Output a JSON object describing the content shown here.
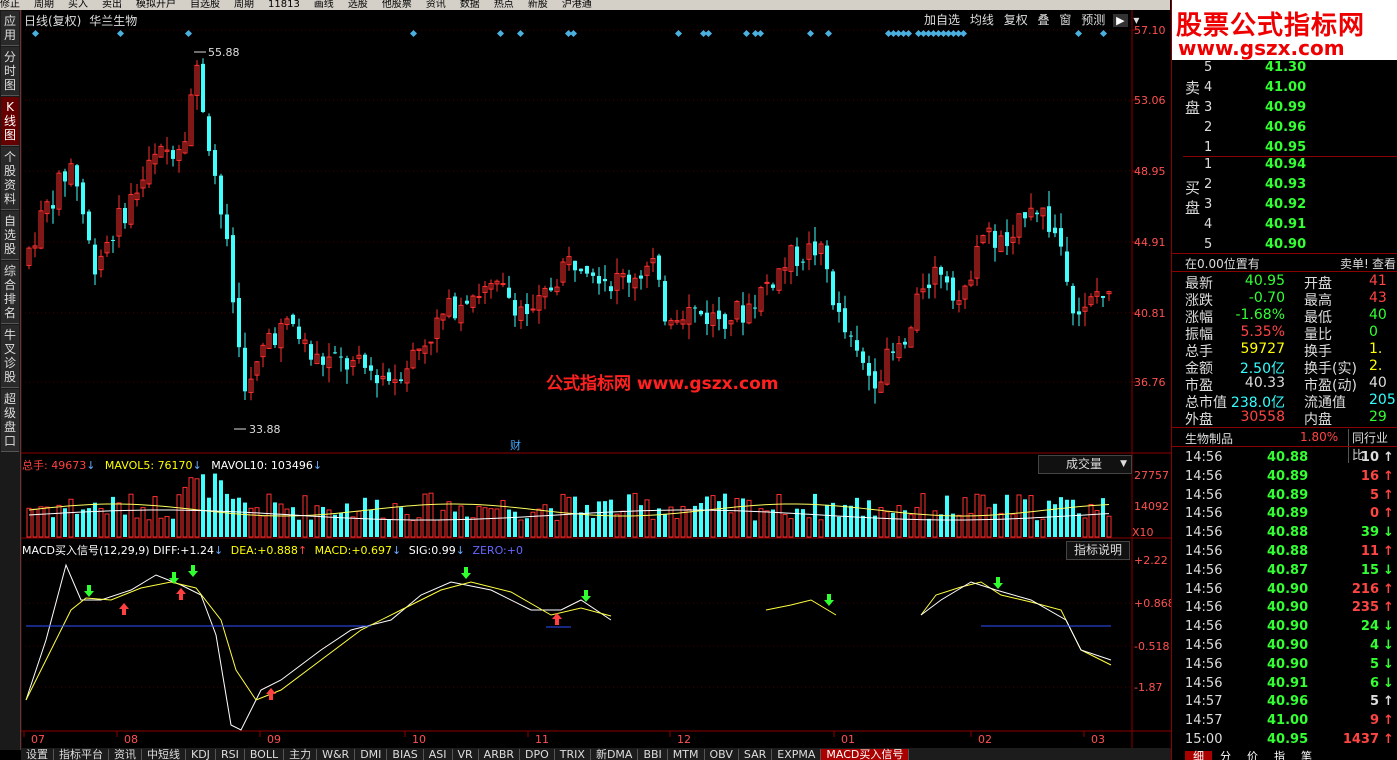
{
  "top_menu": [
    "修正",
    "周期",
    "买入",
    "卖出",
    "模拟开户",
    "自选股",
    "周期",
    "11813",
    "画线",
    "选股",
    "他股票",
    "资讯",
    "数据",
    "热点",
    "新股",
    "沪港通"
  ],
  "sidebar": [
    {
      "label": "应用",
      "active": false
    },
    {
      "label": "分时图",
      "active": false
    },
    {
      "label": "K线图",
      "active": true
    },
    {
      "label": "个股资料",
      "active": false
    },
    {
      "label": "自选股",
      "active": false
    },
    {
      "label": "综合排名",
      "active": false
    },
    {
      "label": "牛叉诊股",
      "active": false
    },
    {
      "label": "超级盘口",
      "active": false
    }
  ],
  "chart": {
    "title_period": "日线(复权)",
    "stock_name": "华兰生物",
    "toolbar": [
      "加自选",
      "均线",
      "复权",
      "叠",
      "窗",
      "预测"
    ],
    "toolbar_arrow": "▶",
    "price_labels": [
      "57.10",
      "53.06",
      "48.95",
      "44.91",
      "40.81",
      "36.76"
    ],
    "high_marker": "55.88",
    "low_marker": "33.88",
    "cai_marker": "财",
    "watermark": "公式指标网  www.gszx.com",
    "volume_header": {
      "label": "总手",
      "value": "49673",
      "ma5_label": "MAVOL5",
      "ma5_value": "76170",
      "ma10_label": "MAVOL10",
      "ma10_value": "103496"
    },
    "volume_select": "成交量",
    "volume_axis": [
      "27757",
      "14092"
    ],
    "volume_unit": "X10",
    "macd_header": {
      "name": "MACD买入信号(12,29,9)",
      "diff_label": "DIFF:",
      "diff_value": "+1.24",
      "dea_label": "DEA:",
      "dea_value": "+0.888",
      "macd_label": "MACD:",
      "macd_value": "+0.697",
      "sig_label": "SIG:",
      "sig_value": "0.99",
      "zero_label": "ZERO:",
      "zero_value": "+0"
    },
    "macd_explain": "指标说明",
    "macd_axis": [
      "+2.22",
      "+0.868",
      "-0.518",
      "-1.87"
    ],
    "x_labels": [
      "07",
      "08",
      "09",
      "10",
      "11",
      "12",
      "01",
      "02",
      "03"
    ]
  },
  "bottom_tabs": [
    "设置",
    "指标平台",
    "资讯",
    "中短线",
    "KDJ",
    "RSI",
    "BOLL",
    "主力",
    "W&R",
    "DMI",
    "BIAS",
    "ASI",
    "VR",
    "ARBR",
    "DPO",
    "TRIX",
    "新DMA",
    "BBI",
    "MTM",
    "OBV",
    "SAR",
    "EXPMA",
    "MACD买入信号"
  ],
  "bottom_active": "MACD买入信号",
  "right": {
    "site_name": "股票公式指标网",
    "site_url": "www.gszx.com",
    "sell_label": "卖盘",
    "buy_label": "买盘",
    "sell": [
      {
        "idx": "5",
        "price": "41.30"
      },
      {
        "idx": "4",
        "price": "41.00"
      },
      {
        "idx": "3",
        "price": "40.99"
      },
      {
        "idx": "2",
        "price": "40.96"
      },
      {
        "idx": "1",
        "price": "40.95"
      }
    ],
    "buy": [
      {
        "idx": "1",
        "price": "40.94"
      },
      {
        "idx": "2",
        "price": "40.93"
      },
      {
        "idx": "3",
        "price": "40.92"
      },
      {
        "idx": "4",
        "price": "40.91"
      },
      {
        "idx": "5",
        "price": "40.90"
      }
    ],
    "position_text": "在0.00位置有",
    "sell_one_label": "卖单!",
    "view_label": "查看",
    "quotes": [
      {
        "l1": "最新",
        "v1": "40.95",
        "c1": "g",
        "l2": "开盘",
        "v2": "41",
        "c2": "r"
      },
      {
        "l1": "涨跌",
        "v1": "-0.70",
        "c1": "g",
        "l2": "最高",
        "v2": "43",
        "c2": "r"
      },
      {
        "l1": "涨幅",
        "v1": "-1.68%",
        "c1": "g",
        "l2": "最低",
        "v2": "40",
        "c2": "g"
      },
      {
        "l1": "振幅",
        "v1": "5.35%",
        "c1": "r",
        "l2": "量比",
        "v2": "0",
        "c2": "g"
      },
      {
        "l1": "总手",
        "v1": "59727",
        "c1": "y",
        "l2": "换手",
        "v2": "1.",
        "c2": "y"
      },
      {
        "l1": "金额",
        "v1": "2.50亿",
        "c1": "c",
        "l2": "换手(实)",
        "v2": "2.",
        "c2": "y"
      },
      {
        "l1": "市盈",
        "v1": "40.33",
        "c1": "w",
        "l2": "市盈(动)",
        "v2": "40",
        "c2": "w"
      },
      {
        "l1": "总市值",
        "v1": "238.0亿",
        "c1": "c",
        "l2": "流通值",
        "v2": "205.",
        "c2": "c"
      },
      {
        "l1": "外盘",
        "v1": "30558",
        "c1": "r",
        "l2": "内盘",
        "v2": "29",
        "c2": "g"
      }
    ],
    "industry_label": "生物制品",
    "industry_change": "1.80%",
    "peer_label": "同行业比",
    "ticks": [
      {
        "t": "14:56",
        "p": "40.88",
        "v": "10",
        "a": "↑",
        "pc": "g",
        "vc": "w"
      },
      {
        "t": "14:56",
        "p": "40.89",
        "v": "16",
        "a": "↑",
        "pc": "g",
        "vc": "r"
      },
      {
        "t": "14:56",
        "p": "40.89",
        "v": "5",
        "a": "↑",
        "pc": "g",
        "vc": "r"
      },
      {
        "t": "14:56",
        "p": "40.89",
        "v": "0",
        "a": "↑",
        "pc": "g",
        "vc": "r"
      },
      {
        "t": "14:56",
        "p": "40.88",
        "v": "39",
        "a": "↓",
        "pc": "g",
        "vc": "g"
      },
      {
        "t": "14:56",
        "p": "40.88",
        "v": "11",
        "a": "↑",
        "pc": "g",
        "vc": "r"
      },
      {
        "t": "14:56",
        "p": "40.87",
        "v": "15",
        "a": "↓",
        "pc": "g",
        "vc": "g"
      },
      {
        "t": "14:56",
        "p": "40.90",
        "v": "216",
        "a": "↑",
        "pc": "g",
        "vc": "r"
      },
      {
        "t": "14:56",
        "p": "40.90",
        "v": "235",
        "a": "↑",
        "pc": "g",
        "vc": "r"
      },
      {
        "t": "14:56",
        "p": "40.90",
        "v": "24",
        "a": "↓",
        "pc": "g",
        "vc": "g"
      },
      {
        "t": "14:56",
        "p": "40.90",
        "v": "4",
        "a": "↓",
        "pc": "g",
        "vc": "g"
      },
      {
        "t": "14:56",
        "p": "40.90",
        "v": "5",
        "a": "↓",
        "pc": "g",
        "vc": "g"
      },
      {
        "t": "14:56",
        "p": "40.91",
        "v": "6",
        "a": "↓",
        "pc": "g",
        "vc": "g"
      },
      {
        "t": "14:57",
        "p": "40.96",
        "v": "5",
        "a": "↑",
        "pc": "g",
        "vc": "w"
      },
      {
        "t": "14:57",
        "p": "41.00",
        "v": "9",
        "a": "↑",
        "pc": "g",
        "vc": "r"
      },
      {
        "t": "15:00",
        "p": "40.95",
        "v": "1437",
        "a": "↑",
        "pc": "g",
        "vc": "r"
      }
    ],
    "bottom_tabs": [
      "细",
      "分",
      "价",
      "指",
      "笔"
    ]
  }
}
